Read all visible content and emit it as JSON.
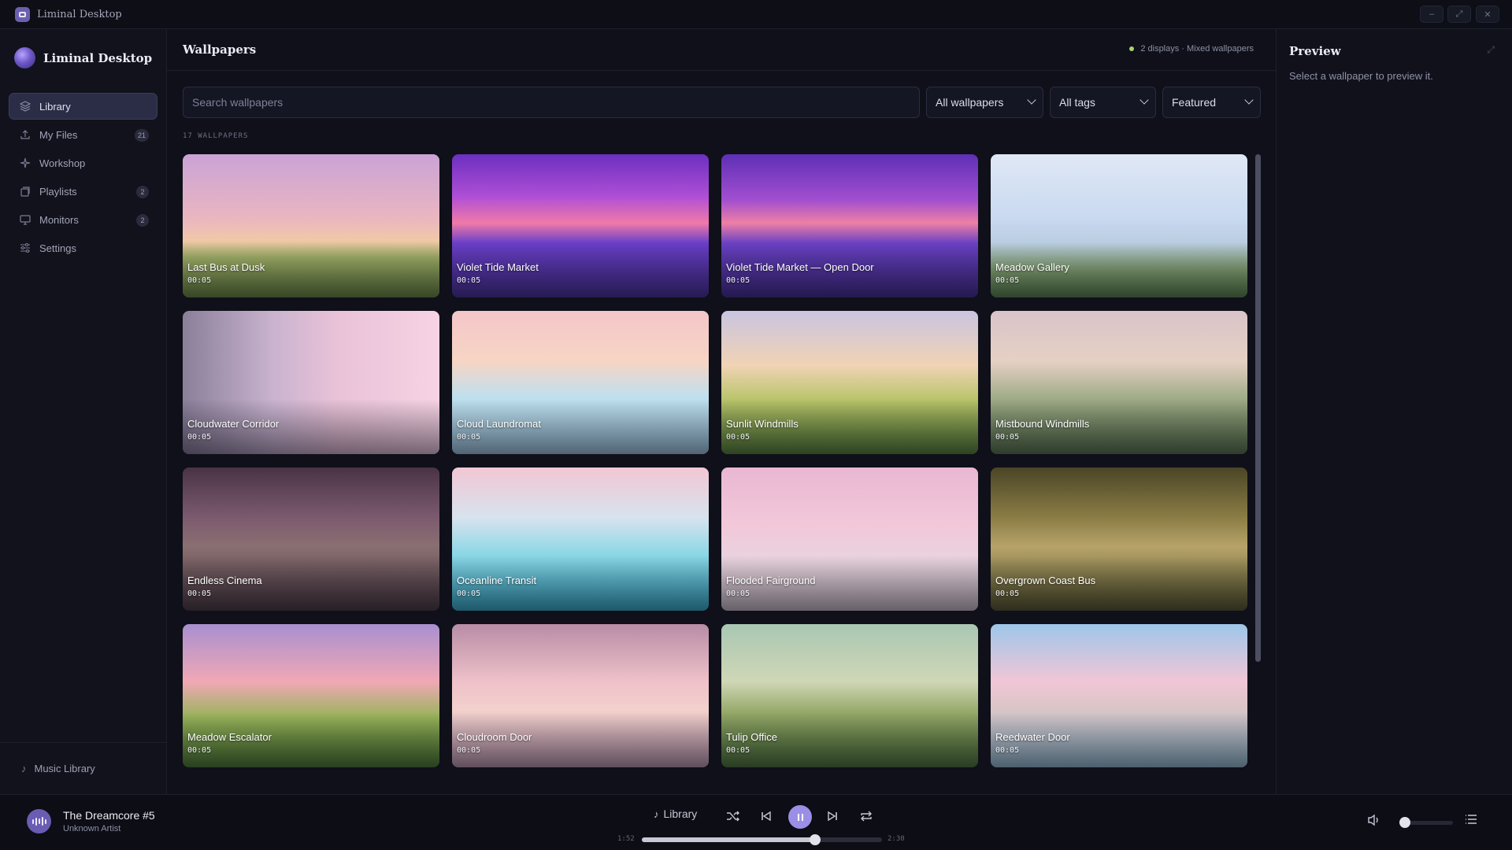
{
  "window": {
    "title": "Liminal Desktop",
    "controls": [
      "–",
      "⤢",
      "✕"
    ]
  },
  "sidebar": {
    "brand": "Liminal Desktop",
    "items": [
      {
        "label": "Library",
        "icon": "layers-icon",
        "badge": ""
      },
      {
        "label": "My Files",
        "icon": "upload-icon",
        "badge": "21"
      },
      {
        "label": "Workshop",
        "icon": "sparkle-icon",
        "badge": ""
      },
      {
        "label": "Playlists",
        "icon": "stack-icon",
        "badge": "2"
      },
      {
        "label": "Monitors",
        "icon": "monitor-icon",
        "badge": "2"
      },
      {
        "label": "Settings",
        "icon": "sliders-icon",
        "badge": ""
      }
    ],
    "footer": "Music Library"
  },
  "main": {
    "title": "Wallpapers",
    "status": "2 displays · Mixed wallpapers",
    "search_placeholder": "Search wallpapers",
    "filters": [
      "All wallpapers",
      "All tags",
      "Featured"
    ],
    "count": "17 WALLPAPERS",
    "wallpapers": [
      {
        "title": "Last Bus at Dusk",
        "duration": "00:05"
      },
      {
        "title": "Violet Tide Market",
        "duration": "00:05"
      },
      {
        "title": "Violet Tide Market — Open Door",
        "duration": "00:05"
      },
      {
        "title": "Meadow Gallery",
        "duration": "00:05"
      },
      {
        "title": "Cloudwater Corridor",
        "duration": "00:05"
      },
      {
        "title": "Cloud Laundromat",
        "duration": "00:05"
      },
      {
        "title": "Sunlit Windmills",
        "duration": "00:05"
      },
      {
        "title": "Mistbound Windmills",
        "duration": "00:05"
      },
      {
        "title": "Endless Cinema",
        "duration": "00:05"
      },
      {
        "title": "Oceanline Transit",
        "duration": "00:05"
      },
      {
        "title": "Flooded Fairground",
        "duration": "00:05"
      },
      {
        "title": "Overgrown Coast Bus",
        "duration": "00:05"
      },
      {
        "title": "Meadow Escalator",
        "duration": "00:05"
      },
      {
        "title": "Cloudroom Door",
        "duration": "00:05"
      },
      {
        "title": "Tulip Office",
        "duration": "00:05"
      },
      {
        "title": "Reedwater Door",
        "duration": "00:05"
      }
    ]
  },
  "preview": {
    "title": "Preview",
    "hint": "Select a wallpaper to preview it."
  },
  "player": {
    "track_title": "The Dreamcore #5",
    "artist": "Unknown Artist",
    "source": "Library",
    "elapsed": "1:52",
    "total": "2:30",
    "progress": 0.72,
    "volume": 0.05
  },
  "colors": {
    "accent": "#9a8fe6",
    "status_dot": "#a7d46f",
    "background": "#0f1019"
  }
}
